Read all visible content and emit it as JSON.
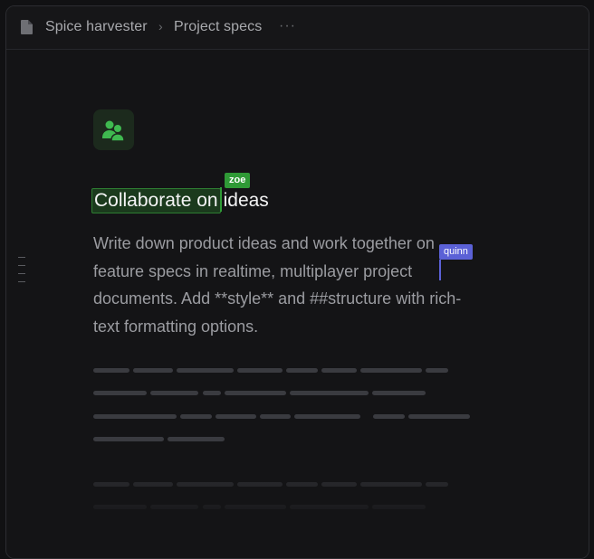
{
  "breadcrumb": {
    "items": [
      "Spice harvester",
      "Project specs"
    ],
    "separator": "›",
    "more": "···"
  },
  "page": {
    "icon": "users-icon",
    "accent": "#3fb950",
    "heading_highlight": "Collaborate on",
    "heading_rest": "ideas",
    "paragraph": "Write down product ideas and work together on feature specs in realtime, multiplayer project documents. Add **style** and ##structure with rich-text formatting options."
  },
  "collaborators": [
    {
      "name": "zoe",
      "color": "#2f9a36"
    },
    {
      "name": "quinn",
      "color": "#5b61d6"
    }
  ]
}
